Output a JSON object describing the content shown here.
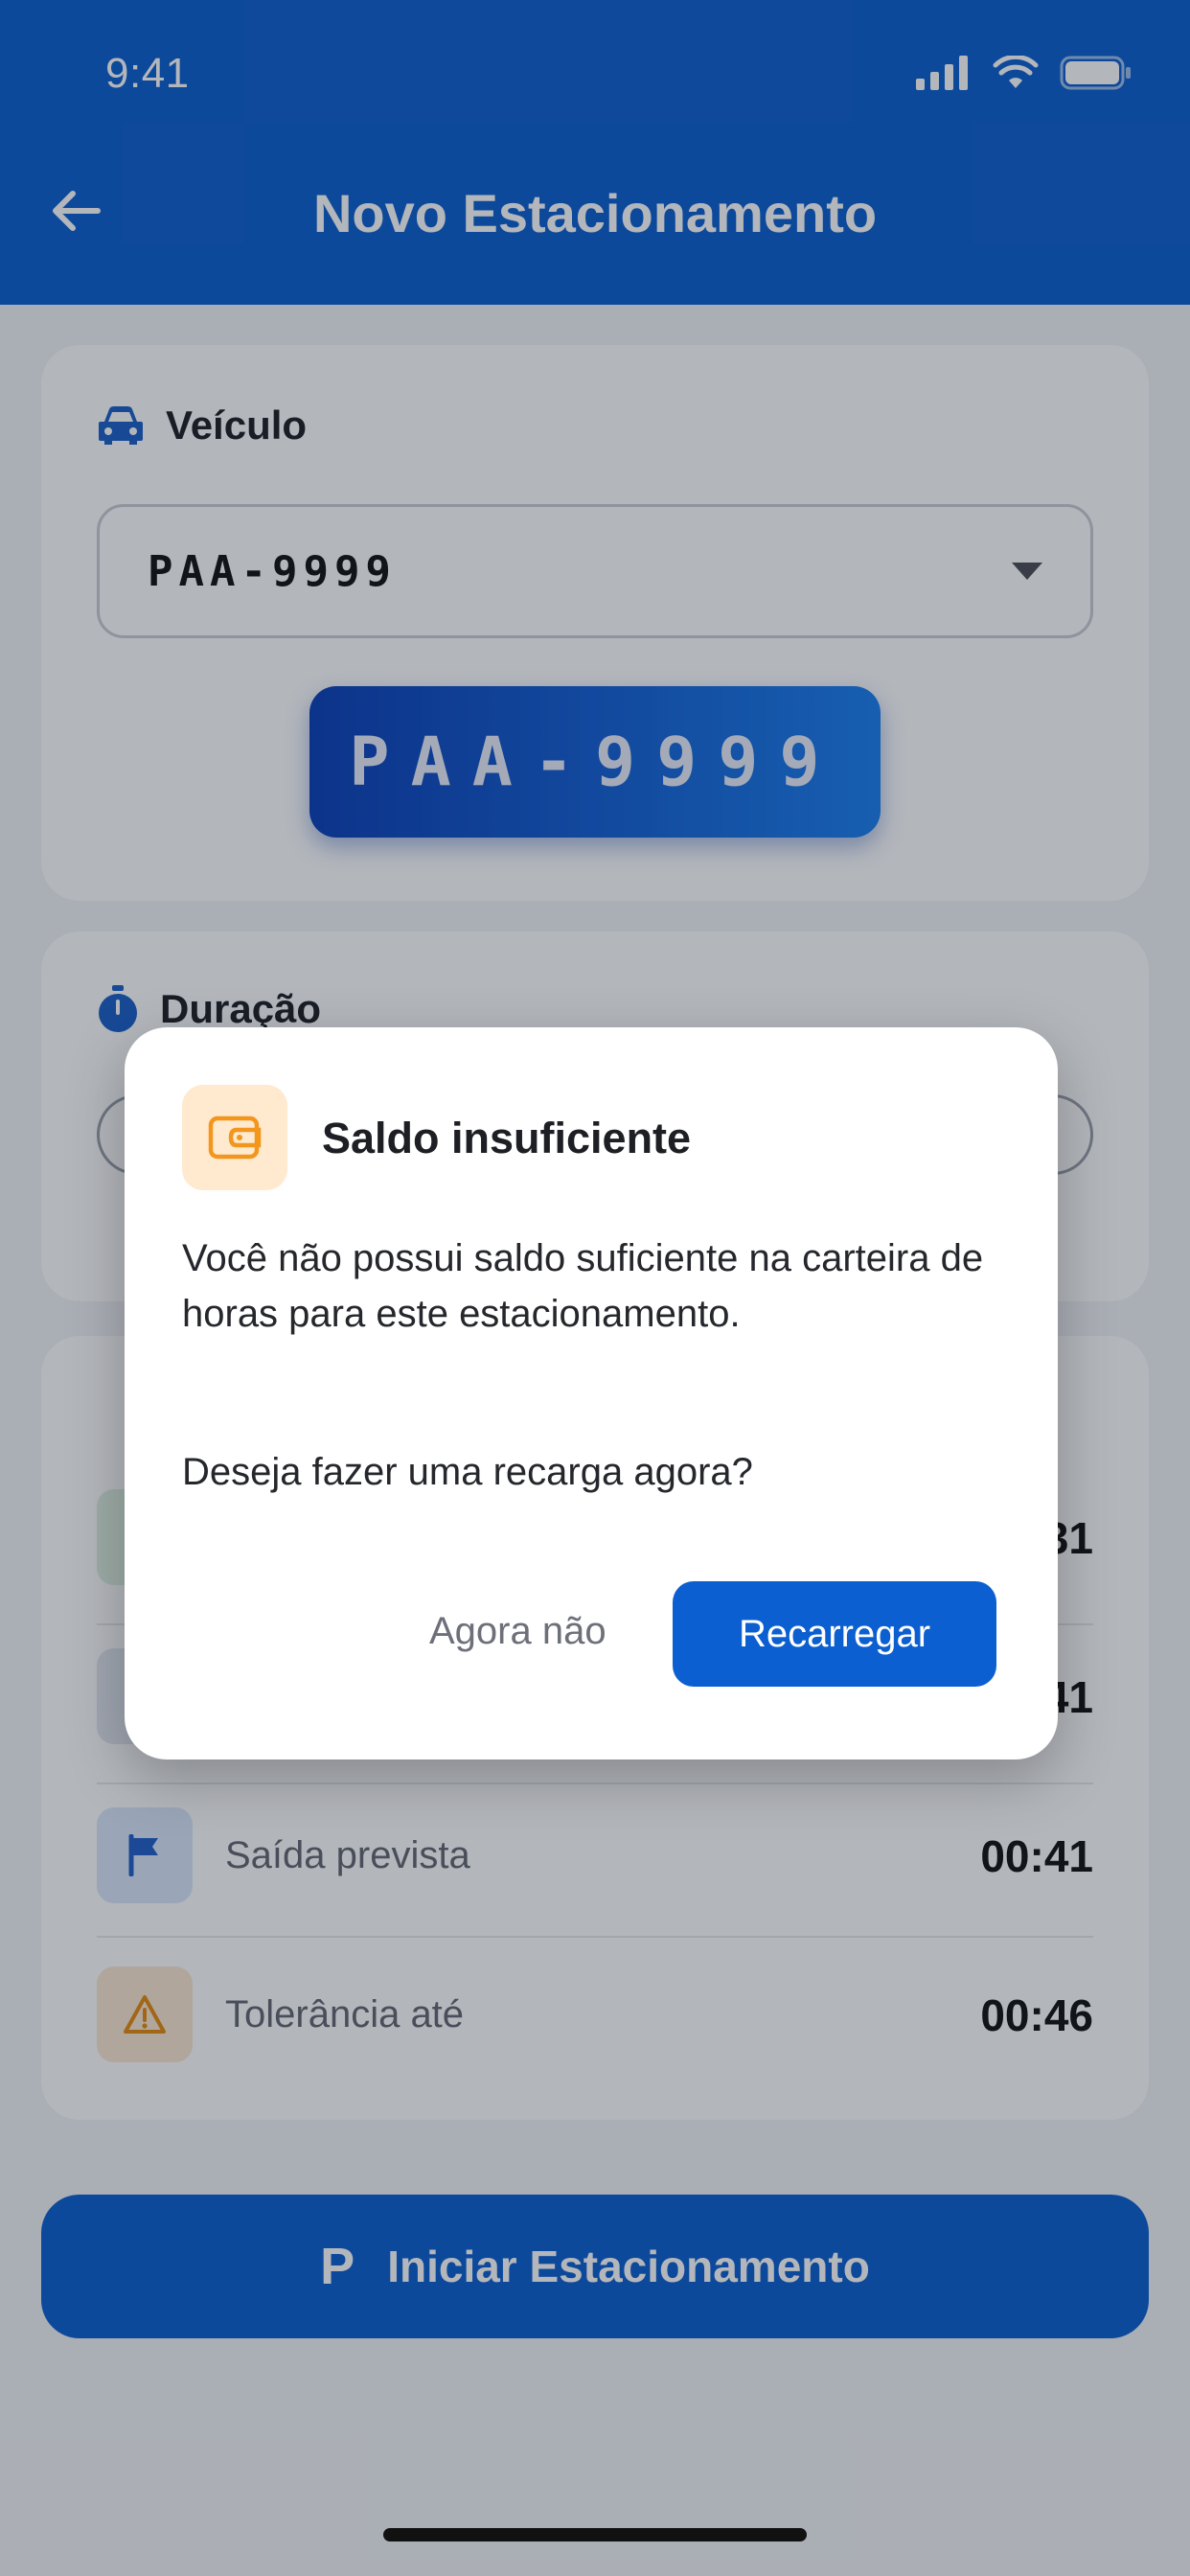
{
  "status_bar": {
    "time": "9:41"
  },
  "header": {
    "title": "Novo Estacionamento"
  },
  "vehicle": {
    "label": "Veículo",
    "selected_plate": "PAA-9999",
    "plate_badge": "PAA-9999"
  },
  "duration": {
    "label": "Duração"
  },
  "times": [
    {
      "icon": "flag-icon",
      "label": "Saída prevista",
      "value": "00:41",
      "color": "#1f5fc7",
      "bg": "#dbe7fb"
    },
    {
      "icon": "warning-icon",
      "label": "Tolerância até",
      "value": "00:46",
      "color": "#e58b10",
      "bg": "#fde8d0"
    }
  ],
  "partial_values": [
    "31",
    "41"
  ],
  "cta": {
    "icon_letter": "P",
    "label": "Iniciar Estacionamento"
  },
  "dialog": {
    "title": "Saldo insuficiente",
    "message": "Você não possui saldo suficiente na carteira de horas para este estacionamento.",
    "question": "Deseja fazer uma recarga agora?",
    "cancel_label": "Agora não",
    "confirm_label": "Recarregar"
  },
  "colors": {
    "primary": "#0b5fd0",
    "warning": "#f3961d"
  }
}
